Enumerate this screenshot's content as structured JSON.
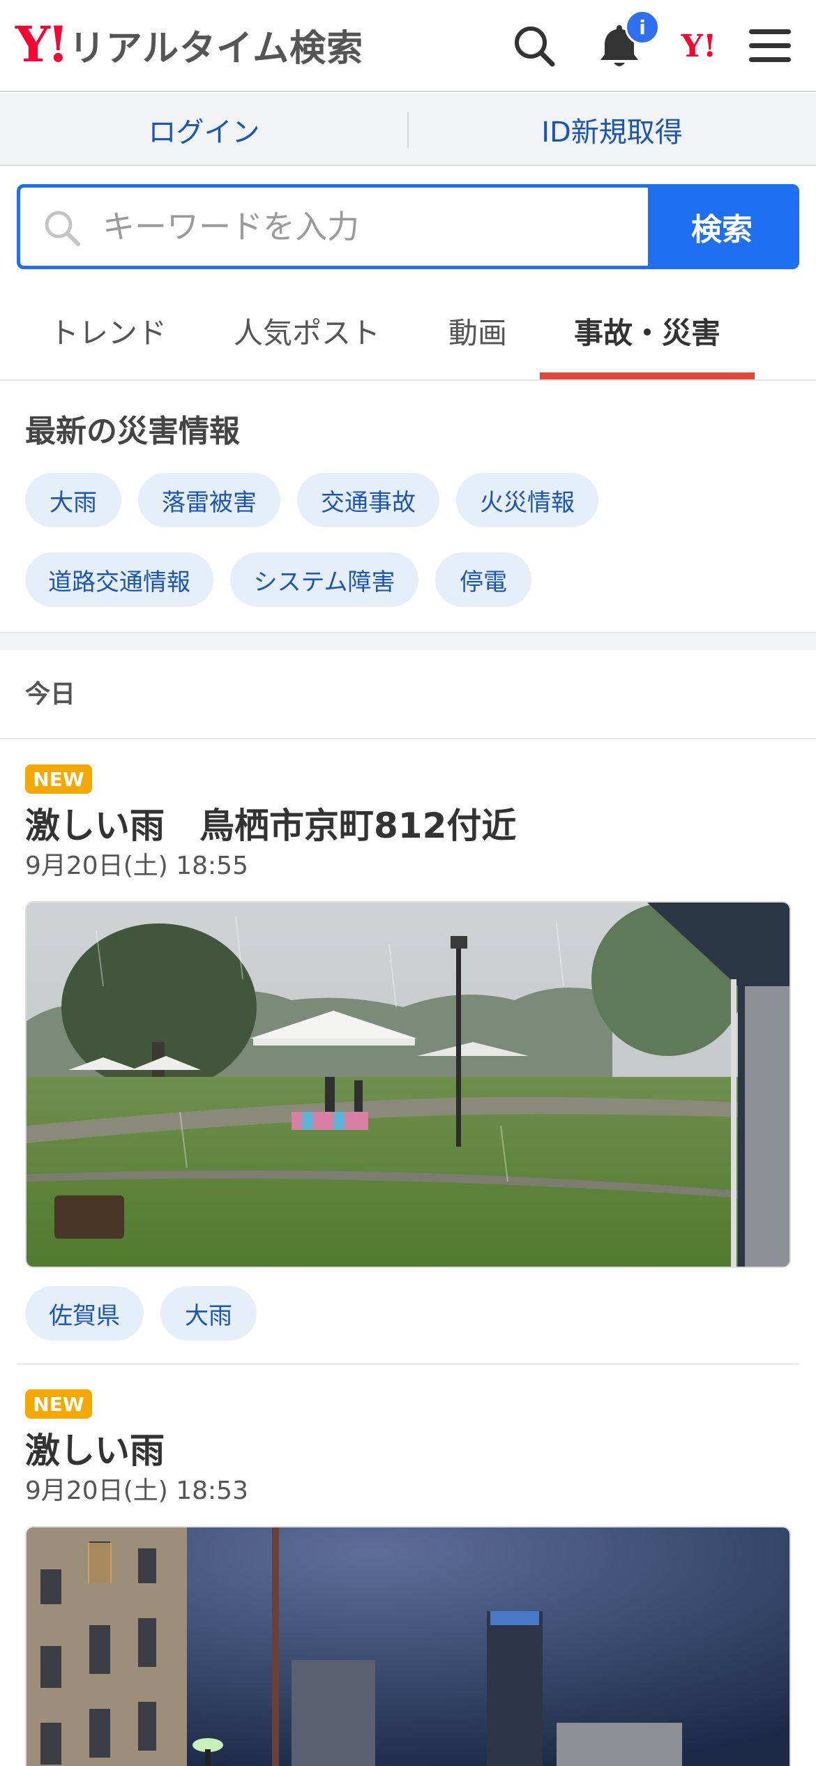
{
  "header": {
    "logo_mark": "Y!",
    "logo_text": "リアルタイム検索",
    "notification_badge": "i",
    "yahoo_icon_text": "Y!"
  },
  "login_bar": {
    "login": "ログイン",
    "signup": "ID新規取得"
  },
  "search": {
    "placeholder": "キーワードを入力",
    "button": "検索"
  },
  "tabs": [
    {
      "label": "トレンド",
      "active": false
    },
    {
      "label": "人気ポスト",
      "active": false
    },
    {
      "label": "動画",
      "active": false
    },
    {
      "label": "事故・災害",
      "active": true
    }
  ],
  "disaster_section": {
    "title": "最新の災害情報",
    "chips": [
      "大雨",
      "落雷被害",
      "交通事故",
      "火災情報",
      "道路交通情報",
      "システム障害",
      "停電"
    ]
  },
  "day_label": "今日",
  "posts": [
    {
      "badge": "NEW",
      "title": "激しい雨　鳥栖市京町812付近",
      "date": "9月20日(土) 18:55",
      "tags": [
        "佐賀県",
        "大雨"
      ]
    },
    {
      "badge": "NEW",
      "title": "激しい雨",
      "date": "9月20日(土) 18:53"
    }
  ],
  "colors": {
    "accent_blue": "#1f6ff2",
    "link_blue": "#1a56b8",
    "yahoo_red": "#ff0033",
    "tab_underline": "#e0453a",
    "new_badge": "#f5a800"
  }
}
